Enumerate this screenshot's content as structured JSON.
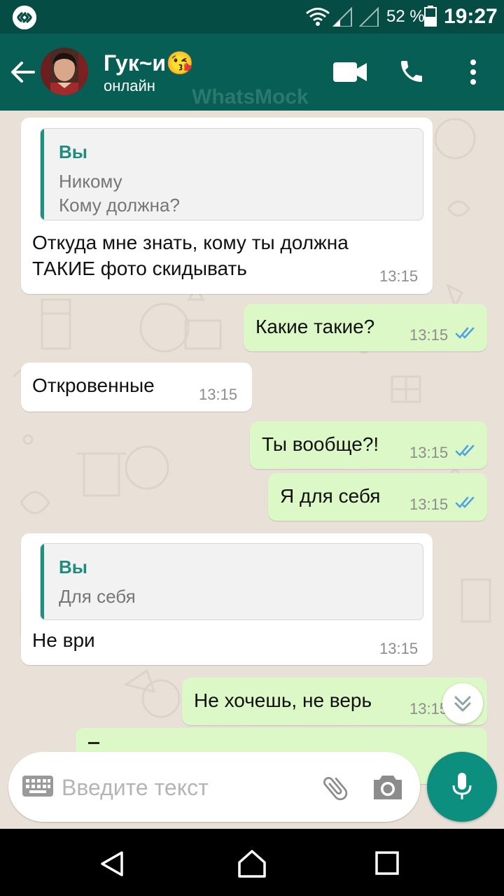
{
  "status_bar": {
    "battery_percent": "52 %",
    "time": "19:27",
    "app_icon": "shazam-icon"
  },
  "header": {
    "contact_name": "Гук~и😘",
    "contact_status": "онлайн",
    "watermark": "WhatsMock",
    "icons": [
      "back-arrow-icon",
      "video-call-icon",
      "phone-icon",
      "more-vert-icon"
    ]
  },
  "messages": [
    {
      "direction": "in",
      "quote": {
        "author": "Вы",
        "text": "Никому\nКому должна?"
      },
      "text": "Откуда мне знать, кому ты должна\nТАКИЕ фото скидывать",
      "time": "13:15"
    },
    {
      "direction": "out",
      "text": "Какие такие?",
      "time": "13:15",
      "read": true
    },
    {
      "direction": "in",
      "text": "Откровенные",
      "time": "13:15"
    },
    {
      "direction": "out",
      "text": "Ты вообще?!",
      "time": "13:15",
      "read": true
    },
    {
      "direction": "out",
      "text": "Я для себя",
      "time": "13:15",
      "read": true
    },
    {
      "direction": "in",
      "quote": {
        "author": "Вы",
        "text": "Для себя"
      },
      "text": "Не ври",
      "time": "13:15"
    },
    {
      "direction": "out",
      "text": "Не хочешь, не верь",
      "time": "13:15",
      "read": true
    }
  ],
  "composer": {
    "placeholder": "Введите текст"
  },
  "colors": {
    "header": "#075e54",
    "status_bar": "#054d44",
    "outgoing_bubble": "#dcf8c6",
    "incoming_bubble": "#ffffff",
    "accent": "#0d8f80",
    "read_ticks": "#4fc3f7"
  }
}
